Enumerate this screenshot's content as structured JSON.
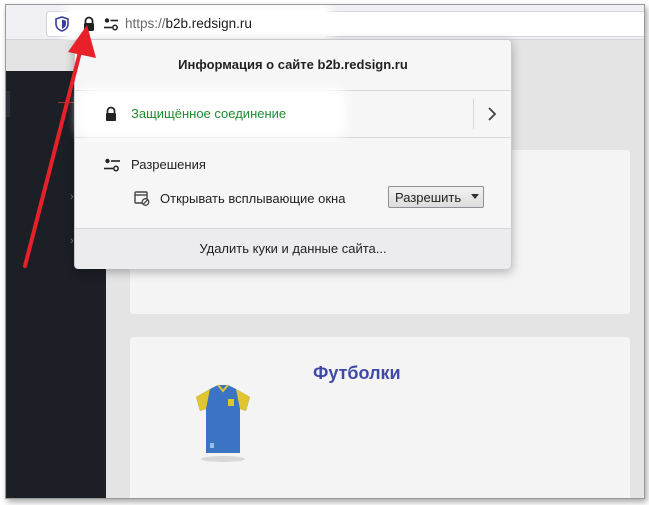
{
  "browser": {
    "url_prefix": "https://",
    "url_domain": "b2b.redsign.ru",
    "icons": {
      "tracking": "shield-icon",
      "lock": "lock-icon",
      "permissions": "permissions-icon"
    }
  },
  "site_info_popup": {
    "title": "Информация о сайте b2b.redsign.ru",
    "connection": {
      "label": "Защищённое соединение",
      "color": "#1f8a2e"
    },
    "permissions": {
      "heading": "Разрешения",
      "items": [
        {
          "label": "Открывать всплывающие окна",
          "value": "Разрешить"
        }
      ]
    },
    "clear_label": "Удалить куки и данные сайта..."
  },
  "page": {
    "card_title": "Футболки",
    "accent_color": "#3f4aa8"
  },
  "annotation": {
    "arrow_color": "#e8202a"
  }
}
